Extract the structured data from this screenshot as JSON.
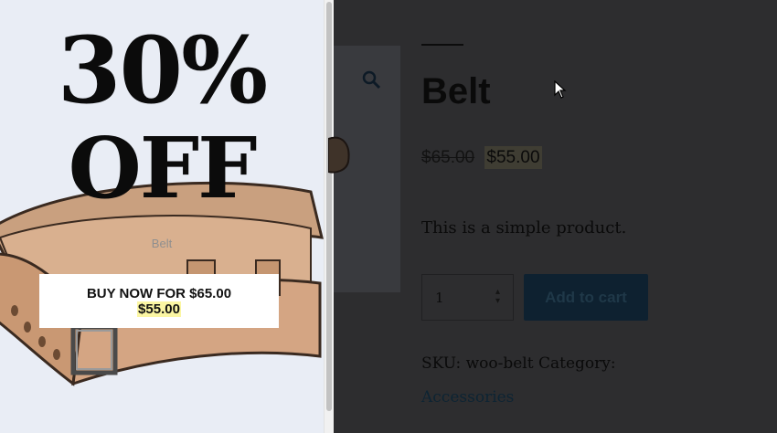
{
  "popup": {
    "headline_line1": "30%",
    "headline_line2": "OFF",
    "image_caption": "Belt",
    "cta_prefix": "BUY NOW FOR $65.00",
    "cta_price": "$55.00"
  },
  "product": {
    "title": "Belt",
    "price_regular": "$65.00",
    "price_sale": "$55.00",
    "description": "This is a simple product.",
    "quantity": "1",
    "add_to_cart_label": "Add to cart",
    "meta_text": "SKU: woo-belt Category:",
    "category_link": "Accessories"
  },
  "icons": {
    "zoom": "magnifier-icon",
    "cursor": "arrow-cursor-icon"
  },
  "colors": {
    "popup_background": "#e9edf5",
    "sale_highlight": "#fbf6a3",
    "overlay_dim": "#2d2d2f",
    "button_dark": "#0e2130"
  }
}
